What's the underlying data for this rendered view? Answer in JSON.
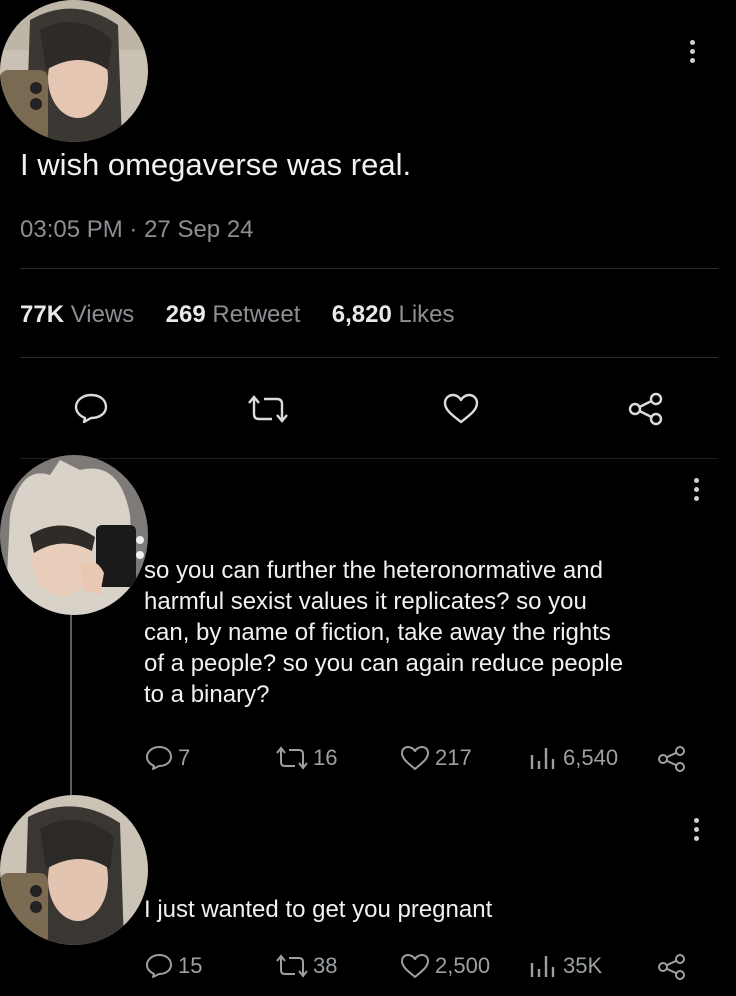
{
  "main_tweet": {
    "avatar": "user-avatar",
    "text": "I wish omegaverse was real.",
    "time": "03:05 PM",
    "separator": "·",
    "date": "27 Sep 24",
    "views_count": "77K",
    "views_label": "Views",
    "retweet_count": "269",
    "retweet_label": "Retweet",
    "likes_count": "6,820",
    "likes_label": "Likes",
    "icons": [
      "more-vertical-icon",
      "reply-icon",
      "retweet-icon",
      "heart-icon",
      "share-icon"
    ]
  },
  "replies": [
    {
      "text_lines": [
        "so you can further the heteronormative and",
        "harmful sexist values it replicates? so you",
        "can, by name of fiction, take away the rights",
        "of a people? so you can again reduce people",
        "to a binary?"
      ],
      "reply_count": "7",
      "retweet_count": "16",
      "like_count": "217",
      "view_count": "6,540"
    },
    {
      "text": "I just wanted to get you pregnant",
      "reply_count": "15",
      "retweet_count": "38",
      "like_count": "2,500",
      "view_count": "35K"
    }
  ],
  "colors": {
    "background": "#000000",
    "text_primary": "#e7e9ea",
    "text_secondary": "#8b8f93",
    "divider": "#2a2d30"
  }
}
